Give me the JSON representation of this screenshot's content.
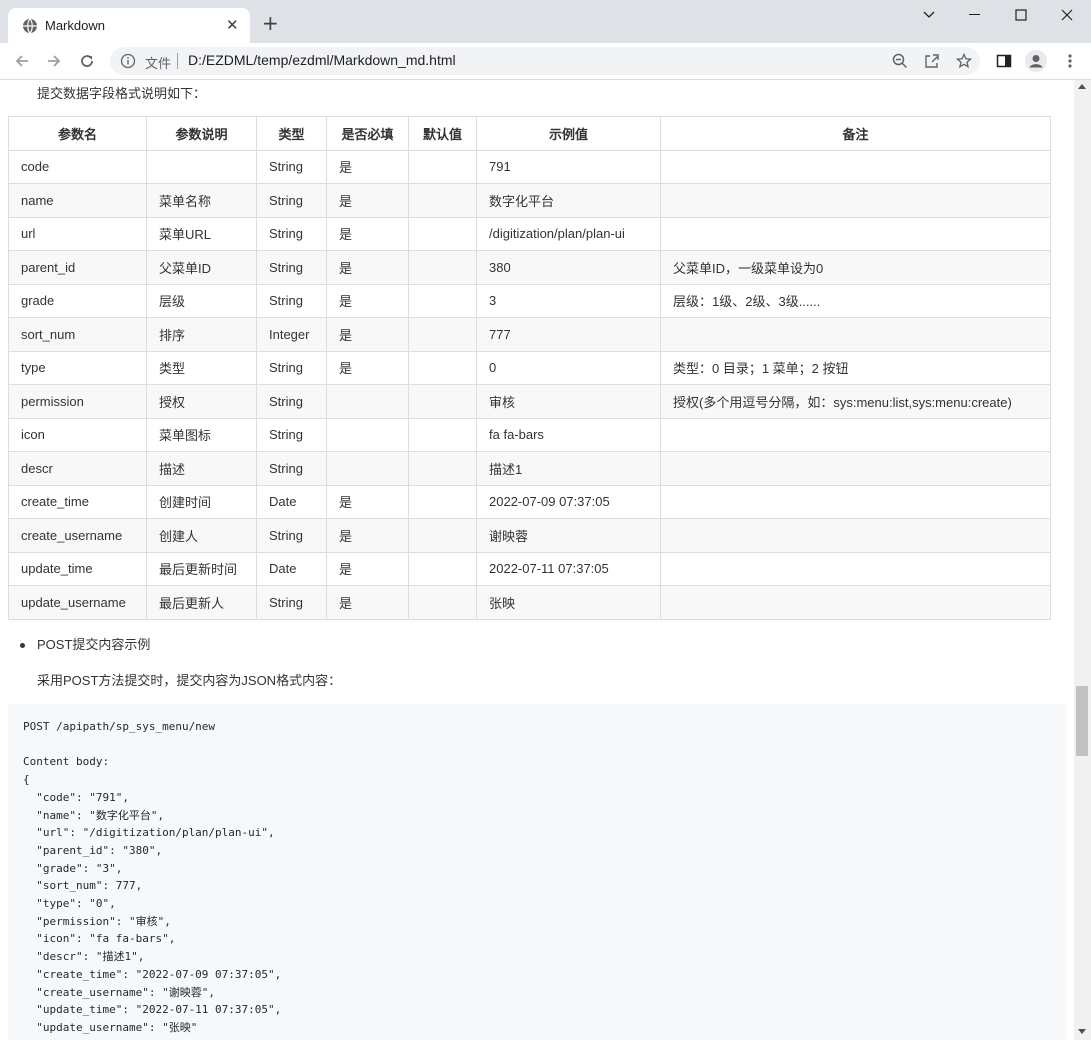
{
  "browser": {
    "tab_title": "Markdown",
    "tab_close": "✕",
    "new_tab": "+",
    "scheme_label": "文件",
    "url": "D:/EZDML/temp/ezdml/Markdown_md.html"
  },
  "doc": {
    "intro": "提交数据字段格式说明如下：",
    "table": {
      "headers": [
        "参数名",
        "参数说明",
        "类型",
        "是否必填",
        "默认值",
        "示例值",
        "备注"
      ],
      "rows": [
        [
          "code",
          "",
          "String",
          "是",
          "",
          "791",
          ""
        ],
        [
          "name",
          "菜单名称",
          "String",
          "是",
          "",
          "数字化平台",
          ""
        ],
        [
          "url",
          "菜单URL",
          "String",
          "是",
          "",
          "/digitization/plan/plan-ui",
          ""
        ],
        [
          "parent_id",
          "父菜单ID",
          "String",
          "是",
          "",
          "380",
          "父菜单ID，一级菜单设为0"
        ],
        [
          "grade",
          "层级",
          "String",
          "是",
          "",
          "3",
          "层级：1级、2级、3级......"
        ],
        [
          "sort_num",
          "排序",
          "Integer",
          "是",
          "",
          "777",
          ""
        ],
        [
          "type",
          "类型",
          "String",
          "是",
          "",
          "0",
          "类型：0 目录；1 菜单；2 按钮"
        ],
        [
          "permission",
          "授权",
          "String",
          "",
          "",
          "审核",
          "授权(多个用逗号分隔，如：sys:menu:list,sys:menu:create)"
        ],
        [
          "icon",
          "菜单图标",
          "String",
          "",
          "",
          "fa fa-bars",
          ""
        ],
        [
          "descr",
          "描述",
          "String",
          "",
          "",
          "描述1",
          ""
        ],
        [
          "create_time",
          "创建时间",
          "Date",
          "是",
          "",
          "2022-07-09 07:37:05",
          ""
        ],
        [
          "create_username",
          "创建人",
          "String",
          "是",
          "",
          "谢映蓉",
          ""
        ],
        [
          "update_time",
          "最后更新时间",
          "Date",
          "是",
          "",
          "2022-07-11 07:37:05",
          ""
        ],
        [
          "update_username",
          "最后更新人",
          "String",
          "是",
          "",
          "张映",
          ""
        ]
      ]
    },
    "bullet": "POST提交内容示例",
    "post_desc": "采用POST方法提交时，提交内容为JSON格式内容：",
    "code": "POST /apipath/sp_sys_menu/new\n\nContent body:\n{\n  \"code\": \"791\",\n  \"name\": \"数字化平台\",\n  \"url\": \"/digitization/plan/plan-ui\",\n  \"parent_id\": \"380\",\n  \"grade\": \"3\",\n  \"sort_num\": 777,\n  \"type\": \"0\",\n  \"permission\": \"审核\",\n  \"icon\": \"fa fa-bars\",\n  \"descr\": \"描述1\",\n  \"create_time\": \"2022-07-09 07:37:05\",\n  \"create_username\": \"谢映蓉\",\n  \"update_time\": \"2022-07-11 07:37:05\",\n  \"update_username\": \"张映\""
  },
  "icons": [
    "globe-icon",
    "close-icon",
    "plus-icon",
    "chevron-down-icon",
    "minimize-icon",
    "maximize-icon",
    "window-close-icon",
    "back-icon",
    "forward-icon",
    "reload-icon",
    "info-icon",
    "zoom-icon",
    "share-icon",
    "star-icon",
    "side-panel-icon",
    "profile-icon",
    "menu-icon"
  ]
}
